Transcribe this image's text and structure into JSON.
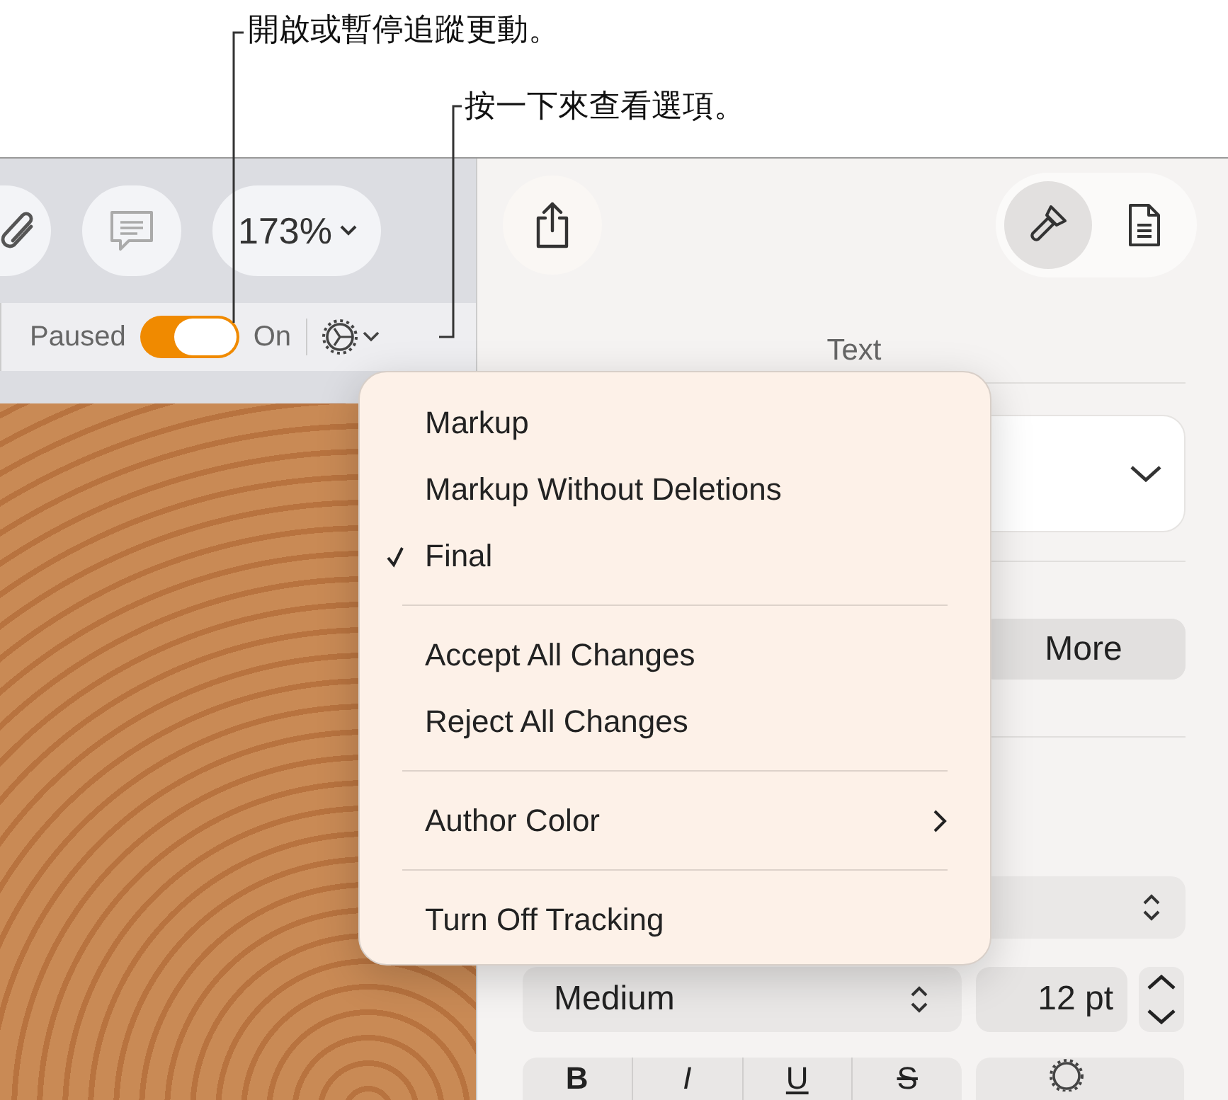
{
  "callouts": [
    {
      "text": "開啟或暫停追蹤更動。"
    },
    {
      "text": "按一下來查看選項。"
    }
  ],
  "toolbar": {
    "zoom": "173%"
  },
  "tracking": {
    "off_label": "Paused",
    "on_label": "On",
    "on": true
  },
  "sidebar": {
    "heading": "Text",
    "more_button": "More",
    "weight": "Medium",
    "size": "12 pt",
    "styles": [
      "B",
      "I",
      "U",
      "S"
    ]
  },
  "menu": {
    "groups": [
      {
        "items": [
          {
            "label": "Markup",
            "checked": false,
            "submenu": false
          },
          {
            "label": "Markup Without Deletions",
            "checked": false,
            "submenu": false
          },
          {
            "label": "Final",
            "checked": true,
            "submenu": false
          }
        ]
      },
      {
        "items": [
          {
            "label": "Accept All Changes",
            "checked": false,
            "submenu": false
          },
          {
            "label": "Reject All Changes",
            "checked": false,
            "submenu": false
          }
        ]
      },
      {
        "items": [
          {
            "label": "Author Color",
            "checked": false,
            "submenu": true
          }
        ]
      },
      {
        "items": [
          {
            "label": "Turn Off Tracking",
            "checked": false,
            "submenu": false
          }
        ]
      }
    ]
  }
}
